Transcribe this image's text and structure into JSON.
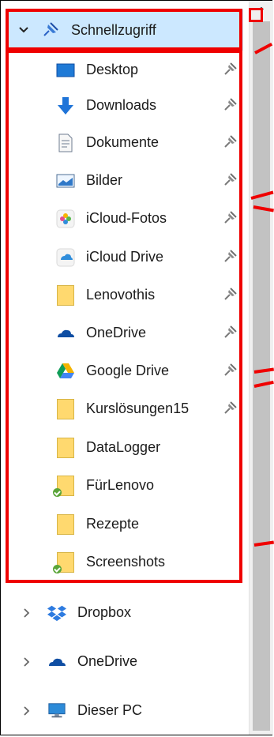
{
  "quick_access": {
    "label": "Schnellzugriff",
    "expand_icon": "chevron-down-icon",
    "icon": "pin-star-icon",
    "items": [
      {
        "label": "Desktop",
        "icon": "desktop-icon",
        "pinned": true
      },
      {
        "label": "Downloads",
        "icon": "download-icon",
        "pinned": true
      },
      {
        "label": "Dokumente",
        "icon": "document-icon",
        "pinned": true
      },
      {
        "label": "Bilder",
        "icon": "image-icon",
        "pinned": true
      },
      {
        "label": "iCloud-Fotos",
        "icon": "icloud-photos-icon",
        "pinned": true
      },
      {
        "label": "iCloud Drive",
        "icon": "icloud-drive-icon",
        "pinned": true
      },
      {
        "label": "Lenovothis",
        "icon": "folder-icon",
        "pinned": true
      },
      {
        "label": "OneDrive",
        "icon": "onedrive-icon",
        "pinned": true
      },
      {
        "label": "Google Drive",
        "icon": "google-drive-icon",
        "pinned": true
      },
      {
        "label": "Kurslösungen15",
        "icon": "folder-icon",
        "pinned": true
      },
      {
        "label": "DataLogger",
        "icon": "folder-icon",
        "pinned": false
      },
      {
        "label": "FürLenovo",
        "icon": "folder-synced-icon",
        "pinned": false
      },
      {
        "label": "Rezepte",
        "icon": "folder-icon",
        "pinned": false
      },
      {
        "label": "Screenshots",
        "icon": "folder-synced-icon",
        "pinned": false
      }
    ]
  },
  "roots": [
    {
      "label": "Dropbox",
      "icon": "dropbox-icon"
    },
    {
      "label": "OneDrive",
      "icon": "onedrive-icon"
    },
    {
      "label": "Dieser PC",
      "icon": "computer-icon"
    }
  ],
  "colors": {
    "selection": "#cce8ff",
    "annotation_red": "#ef0000",
    "folder_yellow": "#ffd96f",
    "scroll_thumb": "#c2c2c2",
    "onedrive_blue": "#0f4ea3"
  }
}
